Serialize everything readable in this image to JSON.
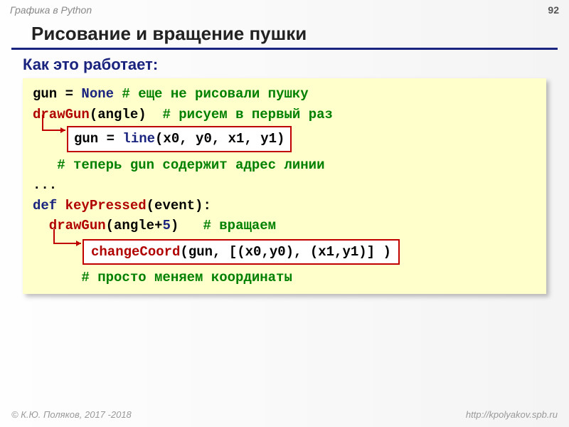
{
  "header": {
    "topic": "Графика в Python",
    "page": "92"
  },
  "title": "Рисование и вращение пушки",
  "subtitle": "Как это работает:",
  "code": {
    "l1_gun": "gun = ",
    "l1_none": "None",
    "l1_cmt": " # еще не рисовали пушку",
    "l2_fn": "drawGun",
    "l2_arg": "(angle)",
    "l2_cmt": "  # рисуем в первый раз",
    "inset1_a": "gun = ",
    "inset1_b": "line",
    "inset1_c": "(x0, y0, x1, y1)",
    "l4_cmt": "   # теперь gun содержит адрес линии",
    "dots": "...",
    "def": "def ",
    "kp": "keyPressed",
    "kp_arg": "(event):",
    "l7_fn": "  drawGun",
    "l7_arg": "(angle+",
    "l7_5": "5",
    "l7_arg2": ")",
    "l7_cmt": "   # вращаем",
    "inset2_a": "changeCoord",
    "inset2_b": "(gun, [(x0,y0), (x1,y1)] )",
    "l9_cmt": "      # просто меняем координаты"
  },
  "footer": {
    "left": "© К.Ю. Поляков, 2017 -2018",
    "right": "http://kpolyakov.spb.ru"
  }
}
